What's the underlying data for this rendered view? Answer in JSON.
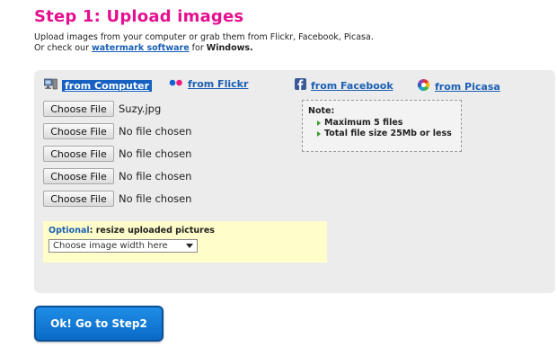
{
  "header": {
    "title": "Step 1: Upload images",
    "line1": "Upload images from your computer or grab them from Flickr, Facebook, Picasa.",
    "line2_prefix": "Or check our ",
    "line2_link": "watermark software",
    "line2_mid": " for ",
    "line2_bold": "Windows."
  },
  "tabs": [
    {
      "label": "from Computer",
      "icon": "computer-icon",
      "active": true
    },
    {
      "label": "from Flickr",
      "icon": "flickr-icon",
      "active": false
    },
    {
      "label": "from Facebook",
      "icon": "facebook-icon",
      "active": false
    },
    {
      "label": "from Picasa",
      "icon": "picasa-icon",
      "active": false
    }
  ],
  "files": [
    {
      "button": "Choose File",
      "name": "Suzy.jpg"
    },
    {
      "button": "Choose File",
      "name": "No file chosen"
    },
    {
      "button": "Choose File",
      "name": "No file chosen"
    },
    {
      "button": "Choose File",
      "name": "No file chosen"
    },
    {
      "button": "Choose File",
      "name": "No file chosen"
    }
  ],
  "note": {
    "heading": "Note:",
    "items": [
      "Maximum 5 files",
      "Total file size 25Mb or less"
    ]
  },
  "optional": {
    "label": "Optional",
    "text": ": resize uploaded pictures",
    "select_value": "Choose image width here"
  },
  "submit_label": "Ok! Go to Step2",
  "colors": {
    "title": "#e5108f",
    "link": "#1a5fb4",
    "button": "#1e8ee5",
    "note_arrow": "#3a9a2a"
  }
}
